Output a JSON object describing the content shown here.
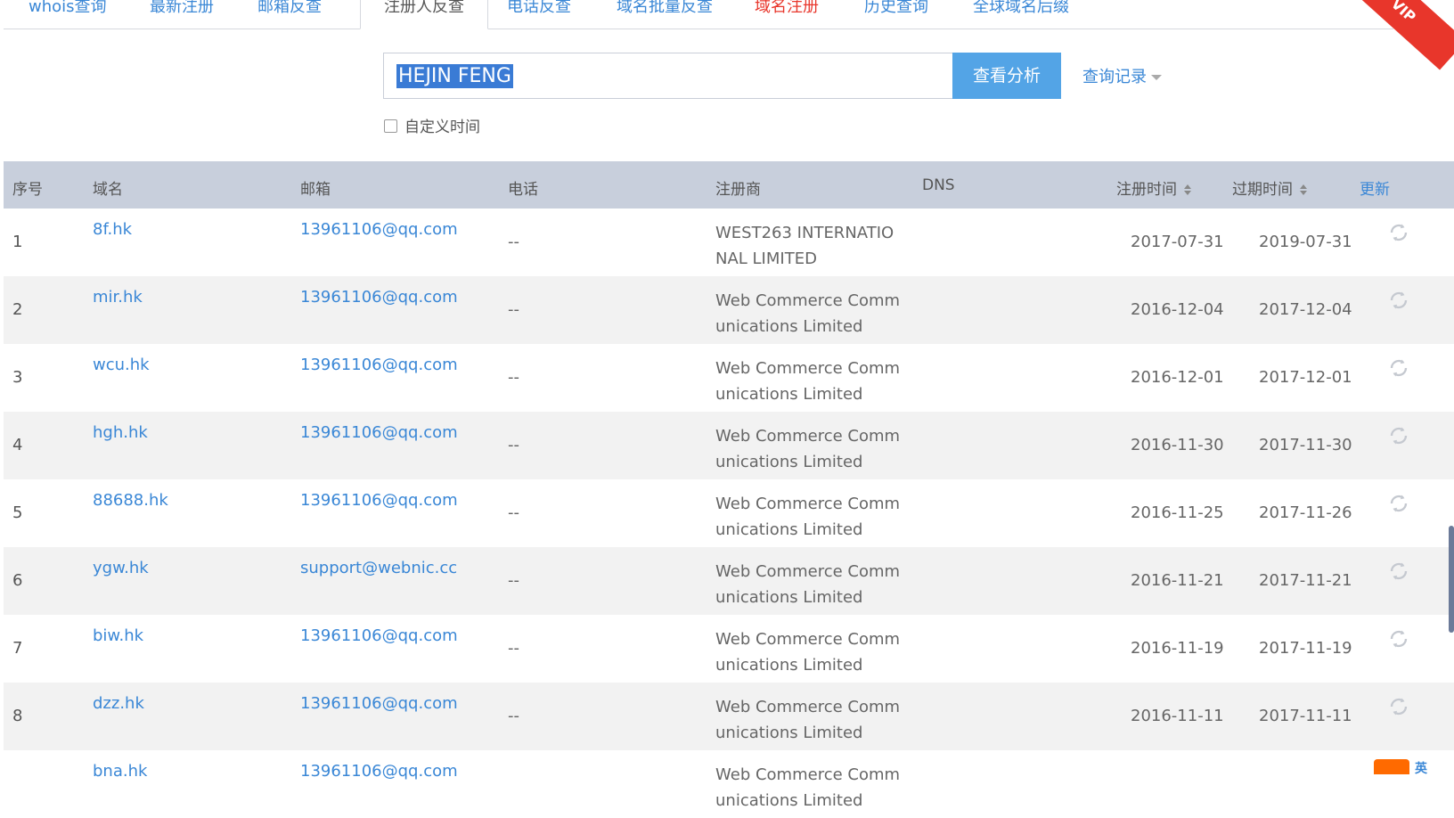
{
  "tabs": [
    {
      "label": "whois查询"
    },
    {
      "label": "最新注册"
    },
    {
      "label": "邮箱反查"
    },
    {
      "label": "注册人反查",
      "active": true
    },
    {
      "label": "电话反查"
    },
    {
      "label": "域名批量反查"
    },
    {
      "label": "域名注册",
      "highlight": "#e8362b"
    },
    {
      "label": "历史查询"
    },
    {
      "label": "全球域名后缀"
    }
  ],
  "vip_badge": "VIP",
  "search": {
    "value": "HEJIN FENG",
    "button_label": "查看分析",
    "history_label": "查询记录",
    "custom_time_label": "自定义时间"
  },
  "table": {
    "headers": {
      "index": "序号",
      "domain": "域名",
      "email": "邮箱",
      "phone": "电话",
      "registrar": "注册商",
      "dns": "DNS",
      "reg_date": "注册时间",
      "exp_date": "过期时间",
      "update": "更新"
    },
    "rows": [
      {
        "index": "1",
        "domain": "8f.hk",
        "email": "13961106@qq.com",
        "phone": "--",
        "registrar": "WEST263 INTERNATIONAL LIMITED",
        "reg_date": "2017-07-31",
        "exp_date": "2019-07-31"
      },
      {
        "index": "2",
        "domain": "mir.hk",
        "email": "13961106@qq.com",
        "phone": "--",
        "registrar": "Web Commerce Communications Limited",
        "reg_date": "2016-12-04",
        "exp_date": "2017-12-04"
      },
      {
        "index": "3",
        "domain": "wcu.hk",
        "email": "13961106@qq.com",
        "phone": "--",
        "registrar": "Web Commerce Communications Limited",
        "reg_date": "2016-12-01",
        "exp_date": "2017-12-01"
      },
      {
        "index": "4",
        "domain": "hgh.hk",
        "email": "13961106@qq.com",
        "phone": "--",
        "registrar": "Web Commerce Communications Limited",
        "reg_date": "2016-11-30",
        "exp_date": "2017-11-30"
      },
      {
        "index": "5",
        "domain": "88688.hk",
        "email": "13961106@qq.com",
        "phone": "--",
        "registrar": "Web Commerce Communications Limited",
        "reg_date": "2016-11-25",
        "exp_date": "2017-11-26"
      },
      {
        "index": "6",
        "domain": "ygw.hk",
        "email": "support@webnic.cc",
        "phone": "--",
        "registrar": "Web Commerce Communications Limited",
        "reg_date": "2016-11-21",
        "exp_date": "2017-11-21"
      },
      {
        "index": "7",
        "domain": "biw.hk",
        "email": "13961106@qq.com",
        "phone": "--",
        "registrar": "Web Commerce Communications Limited",
        "reg_date": "2016-11-19",
        "exp_date": "2017-11-19"
      },
      {
        "index": "8",
        "domain": "dzz.hk",
        "email": "13961106@qq.com",
        "phone": "--",
        "registrar": "Web Commerce Communications Limited",
        "reg_date": "2016-11-11",
        "exp_date": "2017-11-11"
      },
      {
        "index": "",
        "domain": "bna.hk",
        "email": "13961106@qq.com",
        "phone": "",
        "registrar": "Web Commerce Communications Limited",
        "reg_date": "",
        "exp_date": ""
      }
    ]
  },
  "ime_label": "英"
}
